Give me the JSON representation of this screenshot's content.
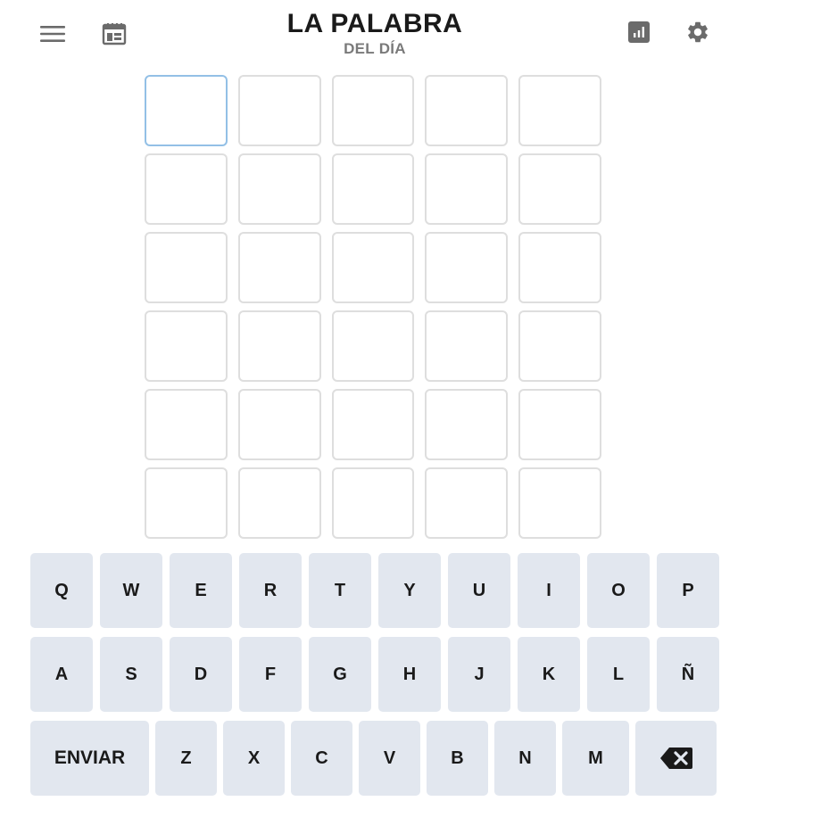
{
  "header": {
    "menu_icon": "hamburger-menu-icon",
    "calendar_icon": "calendar-icon",
    "title": "LA PALABRA",
    "subtitle": "DEL DÍA",
    "stats_icon": "bar-chart-icon",
    "settings_icon": "gear-icon"
  },
  "board": {
    "rows": 6,
    "cols": 5,
    "active_row": 0,
    "active_col": 0,
    "letters": [
      [
        "",
        "",
        "",
        "",
        ""
      ],
      [
        "",
        "",
        "",
        "",
        ""
      ],
      [
        "",
        "",
        "",
        "",
        ""
      ],
      [
        "",
        "",
        "",
        "",
        ""
      ],
      [
        "",
        "",
        "",
        "",
        ""
      ],
      [
        "",
        "",
        "",
        "",
        ""
      ]
    ]
  },
  "keyboard": {
    "row1": [
      "Q",
      "W",
      "E",
      "R",
      "T",
      "Y",
      "U",
      "I",
      "O",
      "P"
    ],
    "row2": [
      "A",
      "S",
      "D",
      "F",
      "G",
      "H",
      "J",
      "K",
      "L",
      "Ñ"
    ],
    "row3": [
      "Z",
      "X",
      "C",
      "V",
      "B",
      "N",
      "M"
    ],
    "enter_label": "ENVIAR",
    "backspace_icon": "backspace-icon"
  },
  "colors": {
    "tile_border": "#dedede",
    "tile_active_border": "#93c0e6",
    "key_background": "#e2e7ef",
    "icon_gray": "#6b6b6b"
  }
}
